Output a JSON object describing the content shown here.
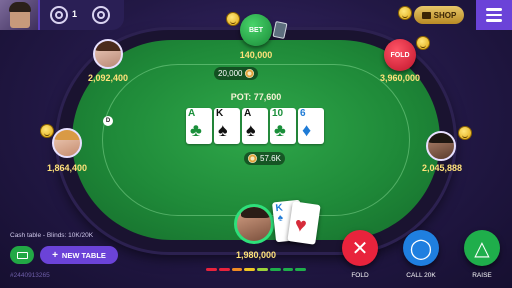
{
  "top_bar": {
    "level_count": "1",
    "shop_label": "SHOP"
  },
  "table": {
    "pot_label": "POT: 77,600",
    "pot_chips": "57.6K",
    "board": [
      {
        "rank": "A",
        "suit": "♣",
        "color": "green"
      },
      {
        "rank": "K",
        "suit": "♠",
        "color": "black"
      },
      {
        "rank": "A",
        "suit": "♠",
        "color": "black"
      },
      {
        "rank": "10",
        "suit": "♣",
        "color": "green"
      },
      {
        "rank": "6",
        "suit": "♦",
        "color": "blue"
      }
    ]
  },
  "players": {
    "top": {
      "action": "BET",
      "stack": "140,000",
      "bet": "20,000",
      "action_color": "#1fae4b"
    },
    "top_left": {
      "stack": "2,092,400"
    },
    "top_right": {
      "action": "FOLD",
      "stack": "3,960,000",
      "action_color": "#d8213a"
    },
    "left": {
      "stack": "1,864,400"
    },
    "right": {
      "stack": "2,045,888"
    },
    "hero": {
      "stack": "1,980,000",
      "cards": [
        {
          "rank": "K",
          "suit": "♠",
          "color": "blue"
        },
        {
          "rank": "",
          "suit": "♥",
          "color": "red"
        }
      ]
    }
  },
  "bottom": {
    "table_info": "Cash table - Blinds: 10K/20K",
    "new_table_label": "NEW TABLE",
    "new_table_plus": "+",
    "hand_id": "#2440913265"
  },
  "actions": {
    "fold": {
      "label": "FOLD",
      "symbol": "✕",
      "color": "#e8233c"
    },
    "call": {
      "label": "CALL 20K",
      "symbol": "◯",
      "color": "#1f7fe0"
    },
    "raise": {
      "label": "RAISE",
      "symbol": "△",
      "color": "#1fae4b"
    }
  },
  "dealer_label": "D"
}
